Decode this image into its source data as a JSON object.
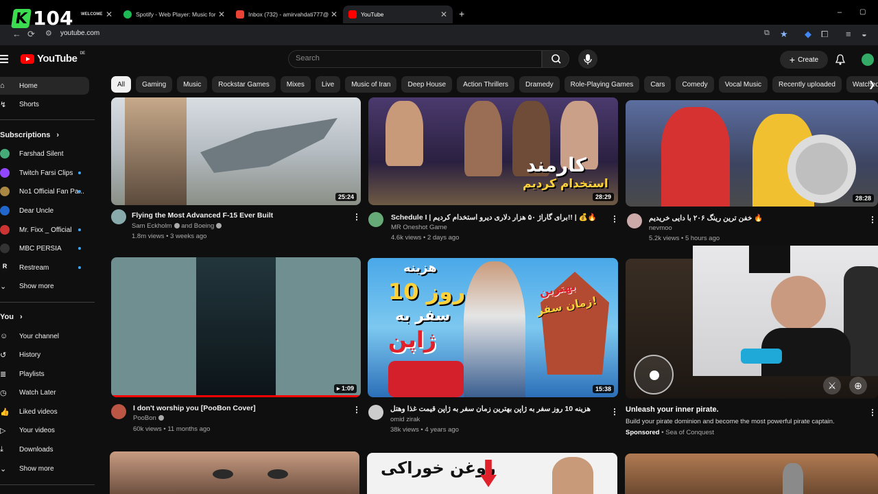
{
  "browser": {
    "tabs": [
      {
        "label": "WELCOME",
        "color": "#6b6bff"
      },
      {
        "label": "Spotify - Web Player: Music for",
        "color": "#1db954"
      },
      {
        "label": "Inbox (732) - amirvahdati777@",
        "color": "#ea4335"
      },
      {
        "label": "YouTube",
        "color": "#ff0000"
      }
    ],
    "url": "youtube.com",
    "overlay_logo": "104",
    "overlay_k": "K"
  },
  "header": {
    "logo": "YouTube",
    "region": "DE",
    "search_placeholder": "Search",
    "create_label": "Create"
  },
  "chips": [
    "All",
    "Gaming",
    "Music",
    "Rockstar Games",
    "Mixes",
    "Live",
    "Music of Iran",
    "Deep House",
    "Action Thrillers",
    "Dramedy",
    "Role-Playing Games",
    "Cars",
    "Comedy",
    "Vocal Music",
    "Recently uploaded",
    "Watched"
  ],
  "sidebar": {
    "home": "Home",
    "shorts": "Shorts",
    "subscriptions_title": "Subscriptions",
    "subscriptions": [
      {
        "name": "Farshad Silent",
        "color": "#4a7",
        "dot": false
      },
      {
        "name": "Twitch Farsi Clips",
        "color": "#9146ff",
        "dot": true
      },
      {
        "name": "No1 Official Fan Pa...",
        "color": "#a84",
        "dot": true
      },
      {
        "name": "Dear Uncle",
        "color": "#26c",
        "dot": false
      },
      {
        "name": "Mr. Fixx _ Official",
        "color": "#c33",
        "dot": true
      },
      {
        "name": "MBC PERSIA",
        "color": "#333",
        "dot": true
      },
      {
        "name": "Restream",
        "color": "#111",
        "dot": true
      }
    ],
    "show_more_1": "Show more",
    "you_title": "You",
    "you_items": [
      "Your channel",
      "History",
      "Playlists",
      "Watch Later",
      "Liked videos",
      "Your videos",
      "Downloads",
      "Show more"
    ]
  },
  "videos": [
    {
      "title": "Flying the Most Advanced F-15 Ever Built",
      "channel": "Sam Eckholm",
      "channel_extra": "and Boeing",
      "meta": "1.8m views • 3 weeks ago",
      "duration": "25:24"
    },
    {
      "title": "Schedule I | برای گاراژ ۵۰ هزار دلاری دیرو استخدام کردیم!! | 💰🔥",
      "channel": "MR Oneshot Game",
      "meta": "4.6k views • 2 days ago",
      "duration": "28:29",
      "thumb_text_1": "کارمند",
      "thumb_text_2": "استخدام کردیم"
    },
    {
      "title": "خفن ترین رینگ ۲۰۶ با دایی خریدیم 🔥",
      "channel": "nevmoo",
      "meta": "5.2k views • 5 hours ago",
      "duration": "28:28"
    },
    {
      "title": "I don't worship you [PooBon Cover]",
      "channel": "PooBon",
      "meta": "60k views • 11 months ago",
      "duration": "1:09"
    },
    {
      "title": "هزینه 10 روز سفر به ژاپن بهترین زمان سفر به ژاپن قیمت غذا وهتل",
      "channel": "omid zirak",
      "meta": "38k views • 4 years ago",
      "duration": "15:38",
      "thumb_text_1": "هزینه",
      "thumb_text_2": "10 روز",
      "thumb_text_3": "سفر به",
      "thumb_text_4": "ژاپن",
      "thumb_text_5": "بهترین",
      "thumb_text_6": "زمان سفر!"
    }
  ],
  "ad": {
    "title": "Unleash your inner pirate.",
    "desc": "Build your pirate dominion and become the most powerful pirate captain.",
    "sponsored": "Sponsored",
    "advertiser": "• Sea of Conquest"
  },
  "row3": {
    "thumb_text": "روغن خوراکی"
  }
}
